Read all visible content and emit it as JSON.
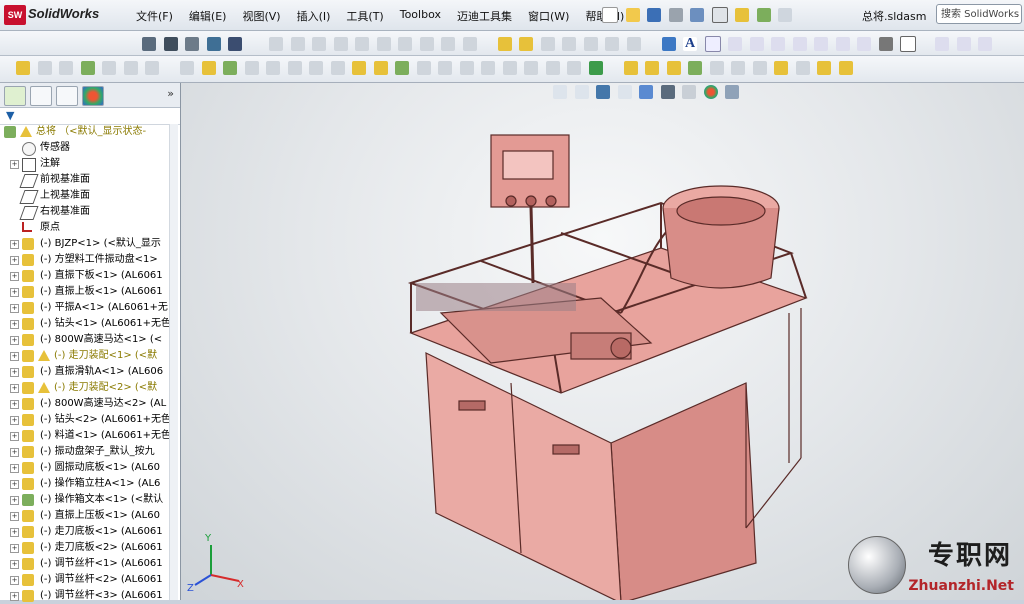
{
  "app": {
    "name": "SolidWorks",
    "logo_text": "SW",
    "document_title": "总将.sldasm",
    "search_placeholder": "搜索 SolidWorks"
  },
  "menu": [
    "文件(F)",
    "编辑(E)",
    "视图(V)",
    "插入(I)",
    "工具(T)",
    "Toolbox",
    "迈迪工具集",
    "窗口(W)",
    "帮助(H)"
  ],
  "sidebar": {
    "root": "总将 （<默认_显示状态-",
    "items": [
      {
        "label": "传感器",
        "icon": "sensor-icon",
        "type": "plain"
      },
      {
        "label": "注解",
        "icon": "annotation-icon",
        "type": "expand"
      },
      {
        "label": "前视基准面",
        "icon": "plane-icon",
        "type": "plain"
      },
      {
        "label": "上视基准面",
        "icon": "plane-icon",
        "type": "plain"
      },
      {
        "label": "右视基准面",
        "icon": "plane-icon",
        "type": "plain"
      },
      {
        "label": "原点",
        "icon": "origin-icon",
        "type": "plain"
      },
      {
        "label": "(-) BJZP<1> (<默认_显示",
        "icon": "part-icon",
        "type": "part"
      },
      {
        "label": "(-) 方塑料工件振动盘<1>",
        "icon": "part-icon",
        "type": "part"
      },
      {
        "label": "(-) 直振下板<1> (AL6061",
        "icon": "part-icon",
        "type": "part"
      },
      {
        "label": "(-) 直振上板<1> (AL6061",
        "icon": "part-icon",
        "type": "part"
      },
      {
        "label": "(-) 平振A<1> (AL6061+无",
        "icon": "part-icon",
        "type": "part"
      },
      {
        "label": "(-) 钻头<1> (AL6061+无色",
        "icon": "part-icon",
        "type": "part"
      },
      {
        "label": "(-) 800W高速马达<1> (<",
        "icon": "part-icon",
        "type": "part"
      },
      {
        "label": "(-) 走刀装配<1> (<默",
        "icon": "assembly-warning-icon",
        "type": "warn"
      },
      {
        "label": "(-) 直振滑轨A<1> (AL606",
        "icon": "part-icon",
        "type": "part"
      },
      {
        "label": "(-) 走刀装配<2> (<默",
        "icon": "assembly-warning-icon",
        "type": "warn"
      },
      {
        "label": "(-) 800W高速马达<2> (AL",
        "icon": "part-icon",
        "type": "part"
      },
      {
        "label": "(-) 钻头<2> (AL6061+无色",
        "icon": "part-icon",
        "type": "part"
      },
      {
        "label": "(-) 料道<1> (AL6061+无色",
        "icon": "part-icon",
        "type": "part"
      },
      {
        "label": "(-) 振动盘架子_默认_按九",
        "icon": "part-icon",
        "type": "part"
      },
      {
        "label": "(-) 圆振动底板<1> (AL60",
        "icon": "part-icon",
        "type": "part"
      },
      {
        "label": "(-) 操作箱立柱A<1> (AL6",
        "icon": "part-icon",
        "type": "part"
      },
      {
        "label": "(-) 操作箱文本<1> (<默认",
        "icon": "assembly-icon",
        "type": "part"
      },
      {
        "label": "(-) 直振上压板<1> (AL60",
        "icon": "part-icon",
        "type": "part"
      },
      {
        "label": "(-) 走刀底板<1> (AL6061",
        "icon": "part-icon",
        "type": "part"
      },
      {
        "label": "(-) 走刀底板<2> (AL6061",
        "icon": "part-icon",
        "type": "part"
      },
      {
        "label": "(-) 调节丝杆<1> (AL6061",
        "icon": "part-icon",
        "type": "part"
      },
      {
        "label": "(-) 调节丝杆<2> (AL6061",
        "icon": "part-icon",
        "type": "part"
      },
      {
        "label": "(-) 调节丝杆<3> (AL6061",
        "icon": "part-icon",
        "type": "part"
      }
    ]
  },
  "viewport": {
    "triad_x": "X",
    "triad_y": "Y",
    "triad_z": "Z"
  },
  "watermark": {
    "cn": "专职网",
    "en": "Zhuanzhi.Net"
  },
  "colors": {
    "model_fill": "#e6a09a",
    "model_edge": "#5a2b28",
    "accent": "#c8102e"
  }
}
